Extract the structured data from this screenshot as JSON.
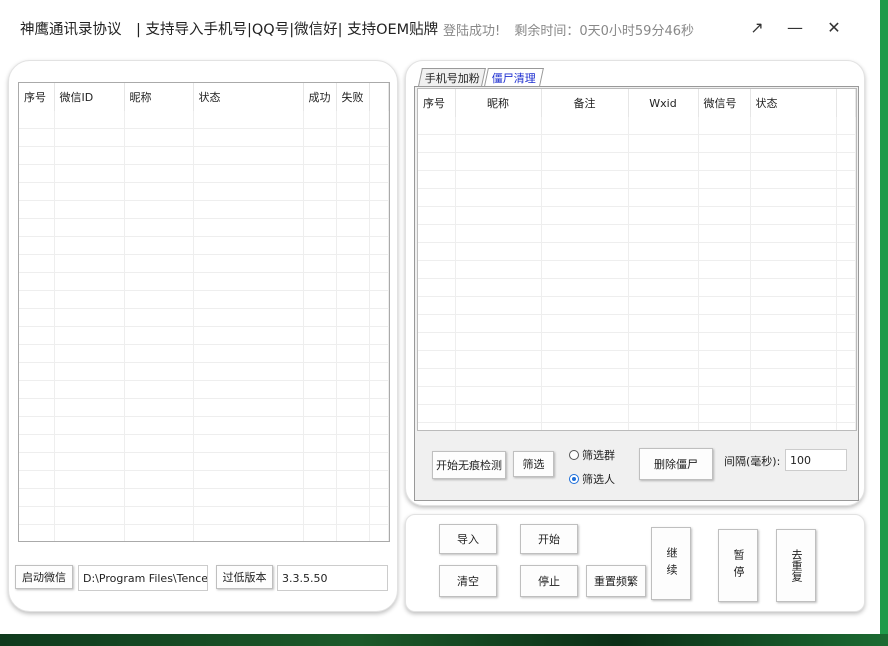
{
  "header": {
    "title": "神鹰通讯录协议　| 支持导入手机号|QQ号|微信好| 支持OEM贴牌",
    "login_status": "登陆成功!",
    "remaining_time": "剩余时间：0天0小时59分46秒",
    "restore_glyph": "↗",
    "minimize_glyph": "—",
    "close_glyph": "✕"
  },
  "left_panel": {
    "columns": [
      "序号",
      "微信ID",
      "昵称",
      "状态",
      "成功",
      "失败"
    ],
    "launch_button": "启动微信",
    "path_value": "D:\\Program Files\\Tencent",
    "lower_version_button": "过低版本",
    "version_value": "3.3.5.50"
  },
  "right_panel": {
    "tabs": [
      "手机号加粉",
      "僵尸清理"
    ],
    "active_tab": 1,
    "columns": [
      "序号",
      "昵称",
      "备注",
      "Wxid",
      "微信号",
      "状态"
    ],
    "start_detect_button": "开始无痕检测",
    "filter_button": "筛选",
    "radio_group": "筛选群",
    "radio_person": "筛选人",
    "radio_selected": "筛选人",
    "delete_zombie_button": "删除僵尸",
    "interval_label": "间隔(毫秒):",
    "interval_value": "100"
  },
  "controls": {
    "import": "导入",
    "start": "开始",
    "clear": "清空",
    "stop": "停止",
    "reset_frequent": "重置频繁",
    "continue": "继续",
    "pause": "暂停",
    "dedupe": "去重复"
  },
  "colors": {
    "active_tab_text": "#1e2fd0",
    "radio_accent": "#1e6fd9",
    "desktop_green": "#1f9a4a"
  }
}
